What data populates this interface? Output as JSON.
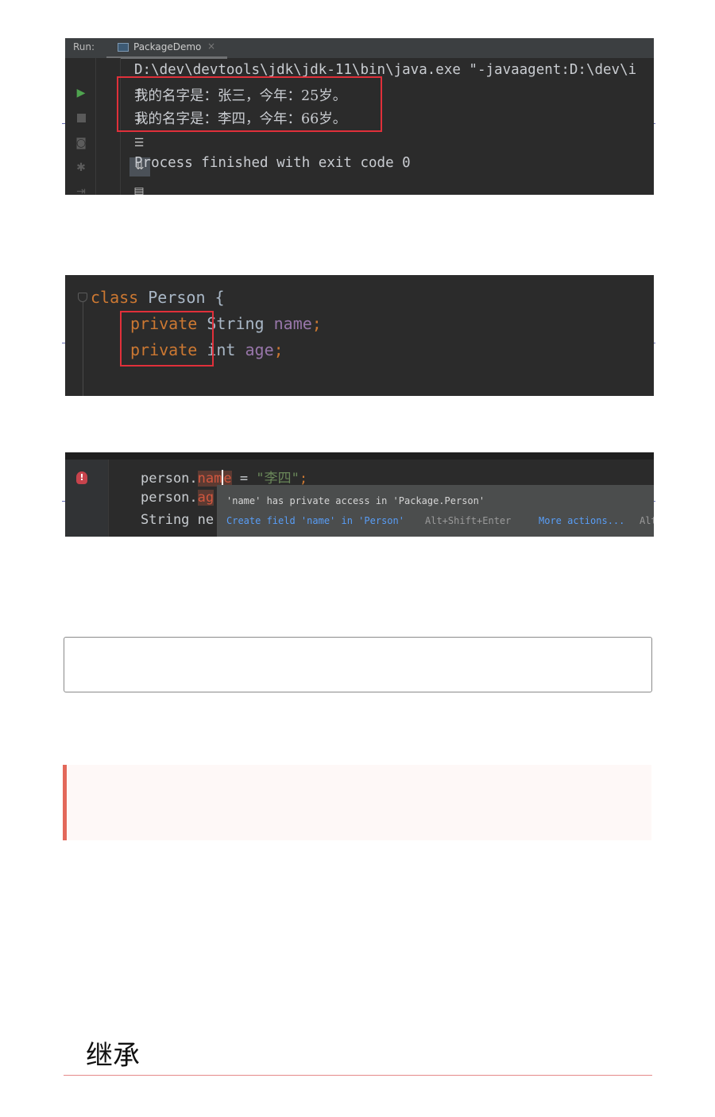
{
  "run_panel": {
    "label": "Run:",
    "tab_title": "PackageDemo",
    "tab_close": "×",
    "toolbar_icons": [
      "run-icon",
      "stop-icon",
      "camera-icon",
      "bug-icon",
      "exit-icon",
      "up-arrow-icon",
      "down-arrow-icon",
      "soft-wrap-icon",
      "scroll-to-end-icon",
      "print-icon"
    ],
    "command_line": "D:\\dev\\devtools\\jdk\\jdk-11\\bin\\java.exe \"-javaagent:D:\\dev\\i",
    "output_lines": [
      "我的名字是：张三，今年：25岁。",
      "我的名字是：李四，今年：66岁。"
    ],
    "exit_message": "Process finished with exit code 0"
  },
  "class_code": {
    "line1_keyword": "class",
    "line1_rest": " Person {",
    "line2_keyword": "private",
    "line2_type": " String ",
    "line2_field": "name",
    "line2_semi": ";",
    "line3_keyword": "private",
    "line3_type": " int ",
    "line3_field": "age",
    "line3_semi": ";"
  },
  "access_code": {
    "line1_prefix": "person.",
    "line1_err_a": "nam",
    "line1_err_b": "e",
    "line1_assign": " = ",
    "line1_string": "\"李四\"",
    "line1_semi": ";",
    "line2_prefix": "person.",
    "line2_err": "ag",
    "line3_text": "String ne",
    "tooltip_message": "'name' has private access in 'Package.Person'",
    "tooltip_fix": "Create field 'name' in 'Person'",
    "tooltip_fix_shortcut": "Alt+Shift+Enter",
    "tooltip_more": "More actions...",
    "tooltip_more_shortcut": "Alt+Enter"
  },
  "heading": "继承",
  "colors": {
    "highlight_red": "#e0303a",
    "note_accent": "#e3685a",
    "heading_rule": "#e58a8a"
  }
}
